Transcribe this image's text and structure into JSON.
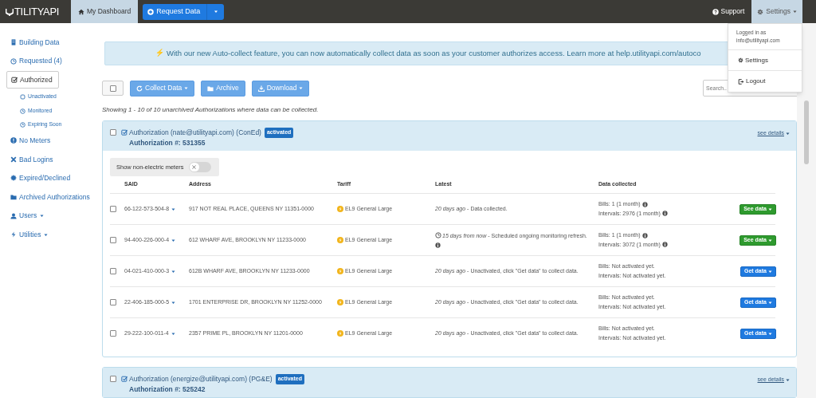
{
  "navbar": {
    "logo_text": "TILITYAPI",
    "left_items": [
      {
        "label": "My Dashboard",
        "kind": "tab",
        "selected": true
      },
      {
        "label": "Request Data",
        "kind": "split-button",
        "selected": false
      }
    ],
    "right_items": [
      {
        "label": "Support",
        "kind": "link",
        "selected": false
      },
      {
        "label": "Settings",
        "kind": "dropdown",
        "selected": true
      }
    ]
  },
  "settings_menu": {
    "header": [
      "Logged in as",
      "info@utilityapi.com"
    ],
    "items": [
      {
        "label": "Settings",
        "kind": "settings"
      },
      {
        "label": "Logout",
        "kind": "logout"
      }
    ]
  },
  "sidebar": {
    "items": [
      {
        "label": "Building Data",
        "selected": false
      },
      {
        "label": "Requested (4)",
        "selected": false
      },
      {
        "label": "Authorized",
        "selected": true,
        "children": [
          {
            "label": "Unactivated"
          },
          {
            "label": "Monitored"
          },
          {
            "label": "Expiring Soon"
          }
        ]
      },
      {
        "label": "No Meters",
        "selected": false
      },
      {
        "label": "Bad Logins",
        "selected": false
      },
      {
        "label": "Expired/Declined",
        "selected": false
      },
      {
        "label": "Archived Authorizations",
        "selected": false
      },
      {
        "label": "Users",
        "selected": false,
        "dropdown": true
      },
      {
        "label": "Utilities",
        "selected": false,
        "dropdown": true
      }
    ]
  },
  "banner": {
    "icon": "⚡",
    "text": "With our new Auto-collect feature, you can now automatically collect data as soon as your customer authorizes access. Learn more at help.utilityapi.com/autoco"
  },
  "toolbar": {
    "select_all_checked": false,
    "buttons": [
      {
        "label": "Collect Data",
        "dropdown": true
      },
      {
        "label": "Archive",
        "dropdown": false
      },
      {
        "label": "Download",
        "dropdown": true
      }
    ],
    "search": {
      "placeholder": "Search.."
    }
  },
  "summary": "Showing 1 - 10 of 10 unarchived Authorizations where data can be collected.",
  "authorizations": [
    {
      "checked": false,
      "title": "Authorization (nate@utilityapi.com) (ConEd)",
      "badge": "activated",
      "number": "Authorization #: 531355",
      "details_link": "see details",
      "toggle": {
        "label": "Show non-electric meters",
        "on": false
      },
      "columns": [
        "SAID",
        "Address",
        "Tariff",
        "Latest",
        "Data collected"
      ],
      "rows": [
        {
          "checked": false,
          "said": "66-122-573-504-8",
          "address": "917 NOT REAL PLACE, QUEENS NY 11351-0000",
          "tariff": "EL9 General Large",
          "scheduled": false,
          "latest": "*20 days ago* - Data collected.",
          "latest_info": false,
          "bills": "Bills: 1 (1 month)",
          "bills_info": true,
          "intervals": "Intervals: 2976 (1 month)",
          "intervals_info": true,
          "action": {
            "label": "See data",
            "kind": "success"
          }
        },
        {
          "checked": false,
          "said": "94-400-226-000-4",
          "address": "612 WHARF AVE, BROOKLYN NY 11233-0000",
          "tariff": "EL9 General Large",
          "scheduled": true,
          "latest": "*15 days from now* - Scheduled ongoing monitoring refresh.",
          "latest_info": true,
          "bills": "Bills: 1 (1 month)",
          "bills_info": true,
          "intervals": "Intervals: 3072 (1 month)",
          "intervals_info": true,
          "action": {
            "label": "See data",
            "kind": "success"
          }
        },
        {
          "checked": false,
          "said": "04-021-410-000-3",
          "address": "612B WHARF AVE, BROOKLYN NY 11233-0000",
          "tariff": "EL9 General Large",
          "scheduled": false,
          "latest": "*20 days ago* - Unactivated, click \"Get data\" to collect data.",
          "latest_info": false,
          "bills": "Bills: Not activated yet.",
          "bills_info": false,
          "intervals": "Intervals: Not activated yet.",
          "intervals_info": false,
          "action": {
            "label": "Get data",
            "kind": "primary"
          }
        },
        {
          "checked": false,
          "said": "22-406-185-000-5",
          "address": "1701 ENTERPRISE DR, BROOKLYN NY 11252-0000",
          "tariff": "EL9 General Large",
          "scheduled": false,
          "latest": "*20 days ago* - Unactivated, click \"Get data\" to collect data.",
          "latest_info": false,
          "bills": "Bills: Not activated yet.",
          "bills_info": false,
          "intervals": "Intervals: Not activated yet.",
          "intervals_info": false,
          "action": {
            "label": "Get data",
            "kind": "primary"
          }
        },
        {
          "checked": false,
          "said": "29-222-100-011-4",
          "address": "2357 PRIME PL, BROOKLYN NY 11201-0000",
          "tariff": "EL9 General Large",
          "scheduled": false,
          "latest": "*20 days ago* - Unactivated, click \"Get data\" to collect data.",
          "latest_info": false,
          "bills": "Bills: Not activated yet.",
          "bills_info": false,
          "intervals": "Intervals: Not activated yet.",
          "intervals_info": false,
          "action": {
            "label": "Get data",
            "kind": "primary"
          }
        }
      ]
    },
    {
      "checked": false,
      "title": "Authorization (energize@utilityapi.com) (PG&E)",
      "badge": "activated",
      "number": "Authorization #: 525242",
      "details_link": "see details"
    }
  ]
}
